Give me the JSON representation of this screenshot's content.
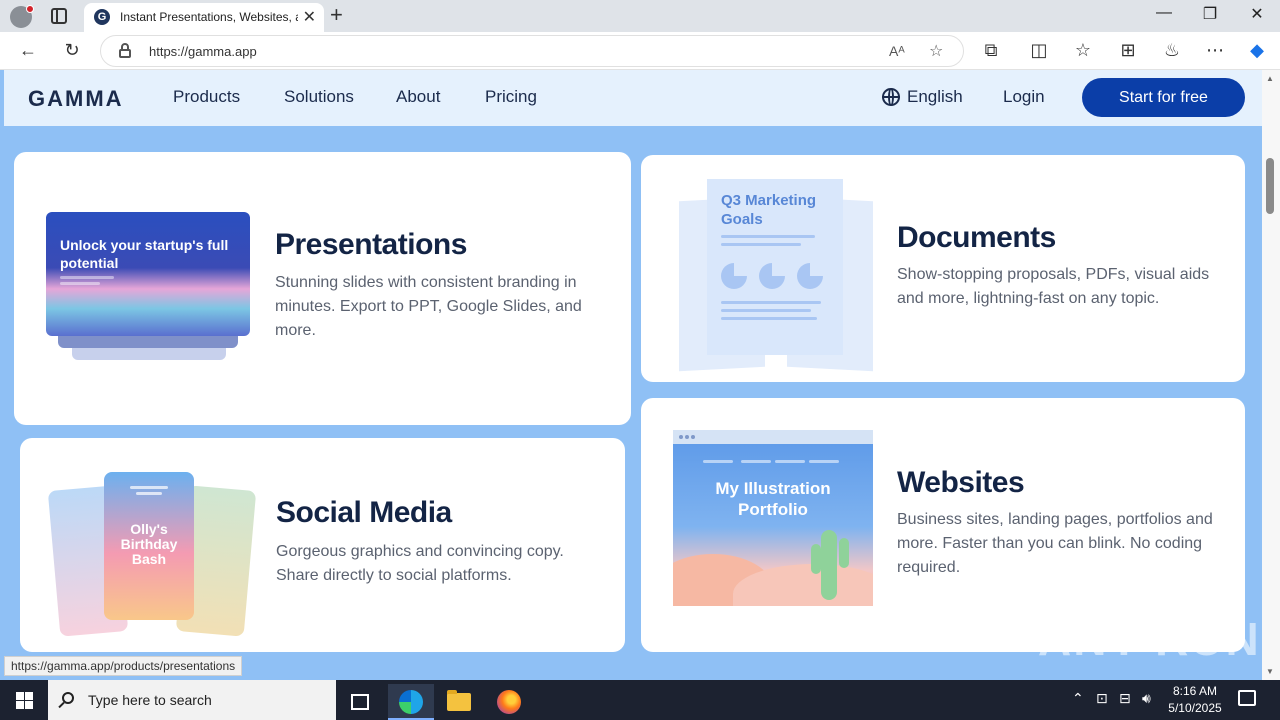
{
  "browser": {
    "tab_title": "Instant Presentations, Websites, a",
    "favicon_letter": "G",
    "tab_close": "✕",
    "new_tab": "+",
    "window_controls": [
      "—",
      "❐",
      "✕"
    ],
    "url": "https://gamma.app",
    "status_url": "https://gamma.app/products/presentations"
  },
  "nav": {
    "logo": "GAMMA",
    "links": [
      "Products",
      "Solutions",
      "About",
      "Pricing"
    ],
    "language": "English",
    "login": "Login",
    "cta": "Start for free"
  },
  "cards": {
    "presentations": {
      "title": "Presentations",
      "desc": "Stunning slides with consistent branding in minutes. Export to PPT, Google Slides, and more.",
      "slide_text": "Unlock your startup's full potential"
    },
    "documents": {
      "title": "Documents",
      "desc": "Show-stopping proposals, PDFs, visual aids and more, lightning-fast on any topic.",
      "doc_text": "Q3 Marketing Goals"
    },
    "social": {
      "title": "Social Media",
      "desc": "Gorgeous graphics and convincing copy. Share directly to social platforms.",
      "post_text": "Olly's Birthday Bash"
    },
    "websites": {
      "title": "Websites",
      "desc": "Business sites, landing pages, portfolios and more. Faster than you can blink. No coding required.",
      "site_text": "My Illustration Portfolio"
    }
  },
  "watermark": "ANY RUN",
  "taskbar": {
    "search_placeholder": "Type here to search",
    "time": "8:16 AM",
    "date": "5/10/2025"
  },
  "colors": {
    "page_bg": "#8fc0f5",
    "nav_bg": "#e5f1fd",
    "cta_bg": "#0b3ea8",
    "title_text": "#132445"
  }
}
